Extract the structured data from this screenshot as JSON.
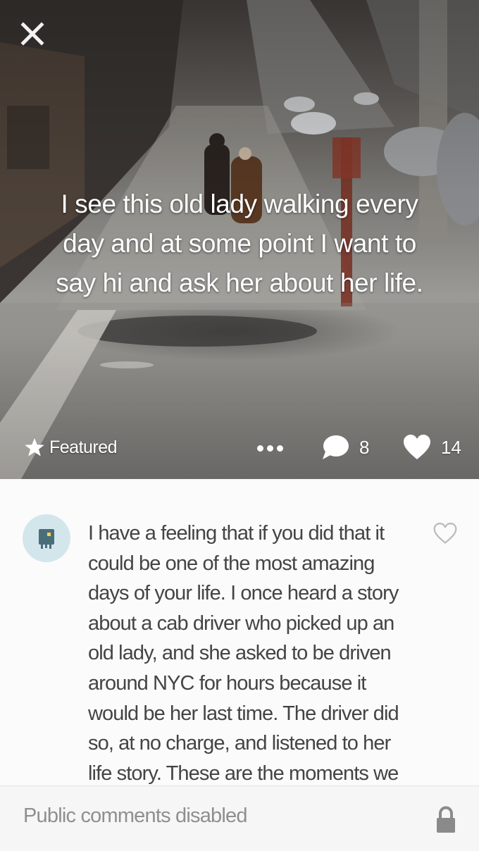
{
  "secret": {
    "text": "I see this old lady walking every day and at some point I want to say hi and ask her about her life.",
    "featured_label": "Featured",
    "comment_count": "8",
    "like_count": "14"
  },
  "comment": {
    "text": "I have a feeling that if you did that it could be one of the most amazing days of your life.  I once heard a story about a cab driver who picked up an old lady, and she asked to be driven around NYC for hours because it would be her last time. The driver did so, at no charge, and listened to her life story.  These are the moments we"
  },
  "footer": {
    "status": "Public comments disabled"
  },
  "icons": {
    "close": "close-icon",
    "star": "star-icon",
    "more": "more-dots-icon",
    "comment": "speech-bubble-icon",
    "like": "heart-icon",
    "avatar": "monster-avatar-icon",
    "lock": "lock-icon"
  },
  "colors": {
    "avatar_bg": "#d3e6ec",
    "avatar_fg": "#4a6d7a",
    "text": "#444444",
    "muted": "#8f8f8f"
  }
}
